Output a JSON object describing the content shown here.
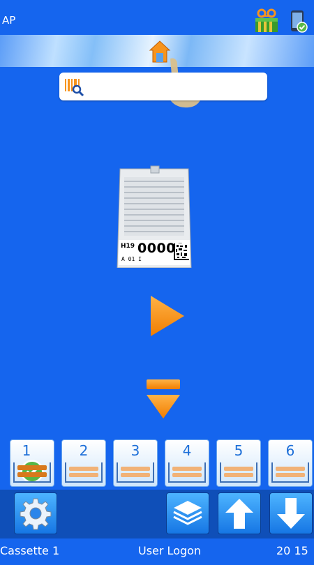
{
  "app": {
    "title": "AP"
  },
  "header": {
    "home_icon": "home-icon",
    "status_icons": [
      "cassette-printer-icon",
      "phone-settings-icon"
    ]
  },
  "search": {
    "placeholder": "",
    "icon": "barcode-search-icon"
  },
  "cassette_preview": {
    "label_prefix": "H19",
    "label_number": "00001",
    "label_sub": "A  01    I"
  },
  "controls": {
    "play_icon": "play-icon",
    "advance_icon": "down-stack-icon"
  },
  "hoppers": [
    {
      "number": "1",
      "selected": true
    },
    {
      "number": "2",
      "selected": false
    },
    {
      "number": "3",
      "selected": false
    },
    {
      "number": "4",
      "selected": false
    },
    {
      "number": "5",
      "selected": false
    },
    {
      "number": "6",
      "selected": false
    }
  ],
  "bottom_buttons": [
    "settings-icon",
    "layers-icon",
    "arrow-up-icon",
    "arrow-down-icon"
  ],
  "status": {
    "left": "Cassette 1",
    "center": "User Logon",
    "right": "20 15"
  },
  "colors": {
    "background": "#1565ee",
    "accent": "#f7941d",
    "hopper_number": "#1d6fd8"
  }
}
